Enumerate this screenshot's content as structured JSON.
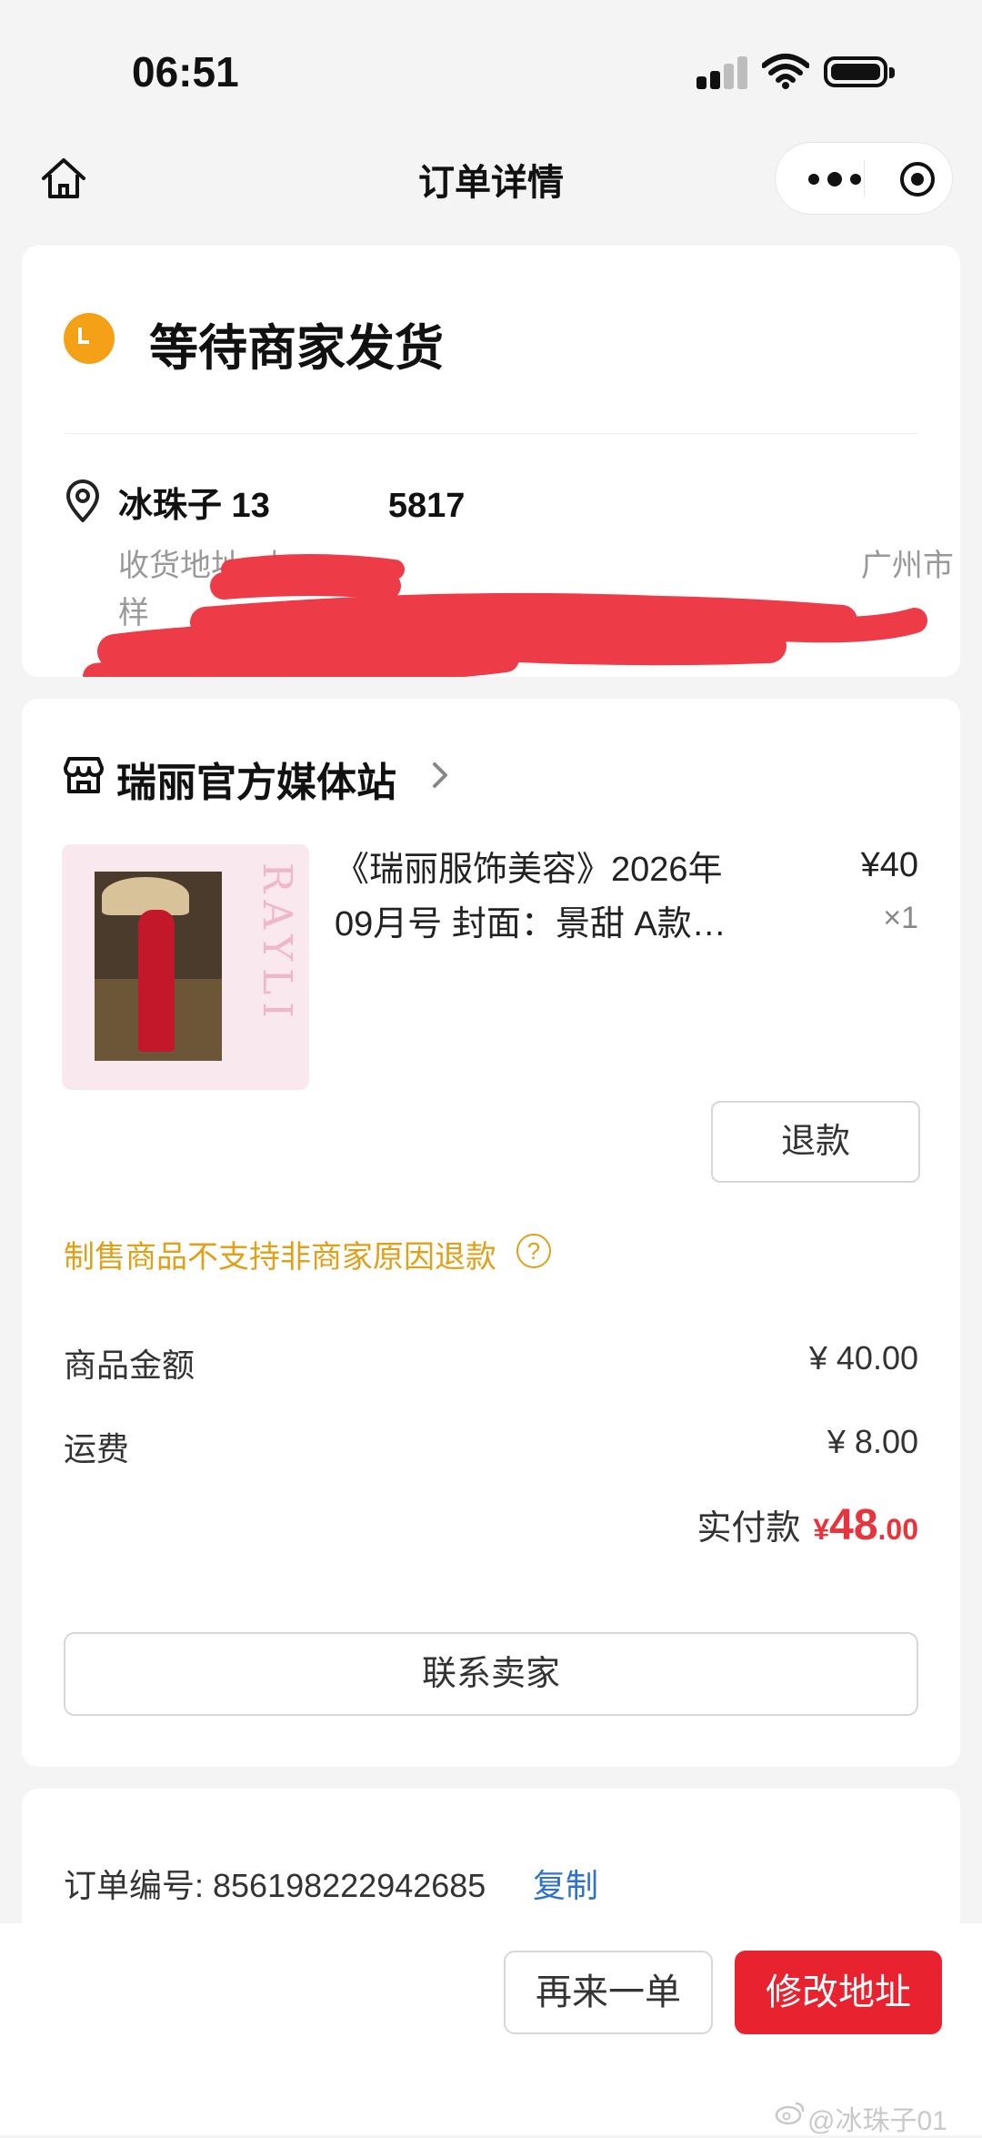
{
  "status_bar": {
    "time": "06:51"
  },
  "nav": {
    "title": "订单详情"
  },
  "order_status": {
    "text": "等待商家发货"
  },
  "address": {
    "recipient": "冰珠子  13",
    "phone_tail": "5817",
    "label": "收货地址: 山",
    "city_tail": "广州市",
    "line2": "样"
  },
  "store": {
    "name": "瑞丽官方媒体站"
  },
  "product": {
    "title_line1": "《瑞丽服饰美容》2026年",
    "title_line2": "09月号 封面：景甜 A款…",
    "price": "¥40",
    "qty": "×1",
    "cover_brand": "RAYLI"
  },
  "refund_button": "退款",
  "refund_note": "制售商品不支持非商家原因退款",
  "help_icon_glyph": "?",
  "summary": {
    "goods_label": "商品金额",
    "goods_value": "¥ 40.00",
    "shipping_label": "运费",
    "shipping_value": "¥ 8.00",
    "total_label": "实付款",
    "total_symbol": "¥",
    "total_int": "48",
    "total_dec": ".00"
  },
  "contact_button": "联系卖家",
  "order_meta": {
    "order_no_label": "订单编号: 856198222942685",
    "copy_label": "复制"
  },
  "actions": {
    "again_label": "再来一单",
    "modify_label": "修改地址"
  },
  "watermark": "@冰珠子01",
  "colors": {
    "accent_red": "#e8232f",
    "price_red": "#e8343d",
    "warning_orange": "#e1a019",
    "status_orange": "#f5a117",
    "link_blue": "#2f72c9",
    "redaction_red": "#ee3b48"
  }
}
